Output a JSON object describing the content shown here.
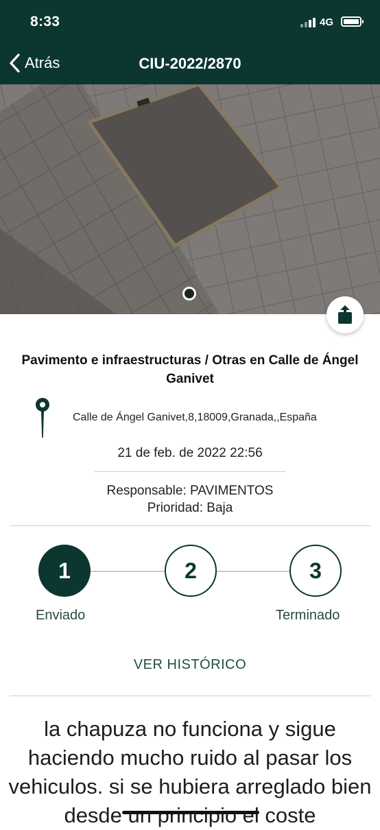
{
  "status_bar": {
    "time": "8:33",
    "network": "4G"
  },
  "nav": {
    "back_label": "Atrás",
    "title": "CIU-2022/2870"
  },
  "incident": {
    "category": "Pavimento e infraestructuras / Otras en Calle de Ángel Ganivet",
    "address": "Calle de Ángel Ganivet,8,18009,Granada,,España",
    "date": "21 de feb. de 2022 22:56",
    "responsable": "Responsable: PAVIMENTOS",
    "prioridad": "Prioridad: Baja"
  },
  "steps": [
    {
      "number": "1",
      "label": "Enviado",
      "active": true
    },
    {
      "number": "2",
      "label": "",
      "active": false
    },
    {
      "number": "3",
      "label": "Terminado",
      "active": false
    }
  ],
  "historico_label": "VER HISTÓRICO",
  "comment": "la chapuza no funciona y sigue haciendo mucho ruido al pasar los vehiculos. si se hubiera arreglado bien desde un principio el coste",
  "colors": {
    "primary": "#0b3730",
    "text": "#1d1d1d"
  }
}
